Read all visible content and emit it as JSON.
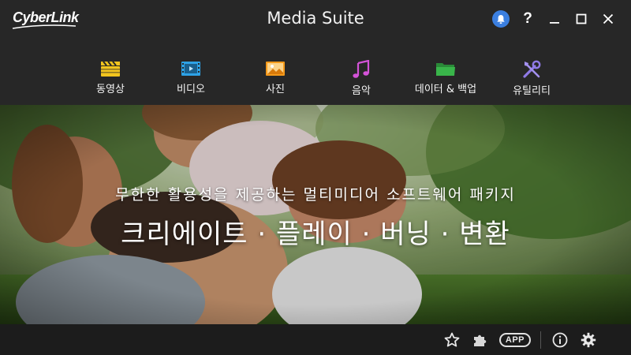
{
  "brand": {
    "logo_text": "CyberLink"
  },
  "window": {
    "title": "Media Suite",
    "help_label": "?",
    "controls": [
      "notification-icon",
      "help",
      "minimize-icon",
      "maximize-icon",
      "close-icon"
    ]
  },
  "categories": [
    {
      "label": "동영상",
      "icon": "clapperboard-icon",
      "color": "#f2c51e"
    },
    {
      "label": "비디오",
      "icon": "film-icon",
      "color": "#2ea2e6"
    },
    {
      "label": "사진",
      "icon": "photo-icon",
      "color": "#f59a1b"
    },
    {
      "label": "음악",
      "icon": "music-note-icon",
      "color": "#d453d8"
    },
    {
      "label": "데이터 & 백업",
      "icon": "folder-icon",
      "color": "#39b54a"
    },
    {
      "label": "유틸리티",
      "icon": "tools-icon",
      "color": "#8f7ae6"
    }
  ],
  "hero": {
    "subtitle": "무한한 활용성을 제공하는 멀티미디어 소프트웨어 패키지",
    "headline": "크리에이트 · 플레이 · 버닝 · 변환"
  },
  "bottom_toolbar": {
    "app_label": "APP",
    "icons": [
      "star-icon",
      "puzzle-icon",
      "app-button",
      "info-icon",
      "settings-gear-icon"
    ]
  },
  "colors": {
    "titlebar_bg": "#272727",
    "accent_blue": "#3b7fe0",
    "bottombar_bg": "#1c1c1c"
  }
}
